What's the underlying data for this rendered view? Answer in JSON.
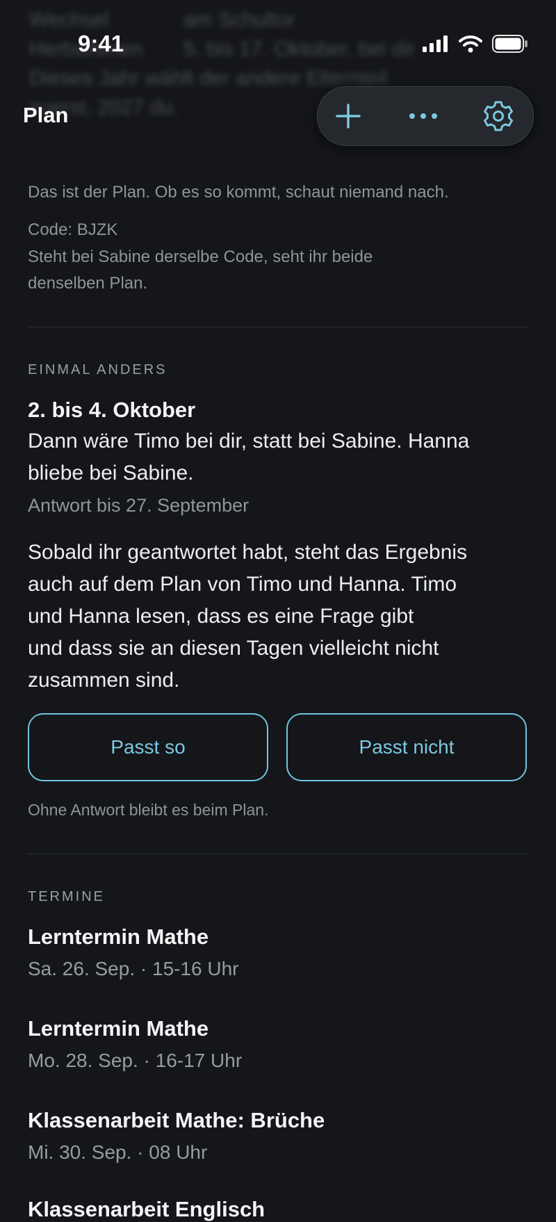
{
  "background_text": {
    "row1_col1": "Wechsel",
    "row1_col2": "am Schultor",
    "row2_col1": "Herbstferien",
    "row2_col2": "5. bis 17. Oktober, bei dir",
    "row3": "Dieses Jahr wählt der andere Elternteil",
    "row4": "zuerst, 2027 du."
  },
  "status_bar": {
    "time": "9:41"
  },
  "header": {
    "title": "Plan"
  },
  "toolbar": {
    "add_icon": "plus-icon",
    "more_icon": "ellipsis-icon",
    "settings_icon": "gear-icon"
  },
  "plan_info": {
    "note": "Das ist der Plan. Ob es so kommt, schaut niemand nach.",
    "code": "Code: BJZK",
    "code_hint_line1": "Steht bei Sabine derselbe Code, seht ihr beide",
    "code_hint_line2": "denselben Plan."
  },
  "einmal_anders": {
    "label": "EINMAL ANDERS",
    "dates": "2. bis 4. Oktober",
    "description_line1": "Dann wäre Timo bei dir, statt bei Sabine. Hanna",
    "description_line2": "bliebe bei Sabine.",
    "deadline": "Antwort bis 27. September",
    "info_line1": "Sobald ihr geantwortet habt, steht das Ergebnis",
    "info_line2": "auch auf dem Plan von Timo und Hanna. Timo",
    "info_line3": "und Hanna lesen, dass es eine Frage gibt",
    "info_line4": "und dass sie an diesen Tagen vielleicht nicht",
    "info_line5": "zusammen sind.",
    "accept_label": "Passt so",
    "decline_label": "Passt nicht",
    "fallback_note": "Ohne Antwort bleibt es beim Plan."
  },
  "termine": {
    "label": "TERMINE",
    "items": [
      {
        "title": "Lerntermin Mathe",
        "when": "Sa. 26. Sep. · 15-16 Uhr"
      },
      {
        "title": "Lerntermin Mathe",
        "when": "Mo. 28. Sep. · 16-17 Uhr"
      },
      {
        "title": "Klassenarbeit Mathe: Brüche",
        "when": "Mi. 30. Sep. · 08 Uhr"
      },
      {
        "title": "Klassenarbeit Englisch",
        "when": ""
      }
    ]
  },
  "colors": {
    "background": "#141619",
    "accent": "#6fc6e0",
    "text": "#f1f2f3",
    "muted": "#8f959b"
  }
}
